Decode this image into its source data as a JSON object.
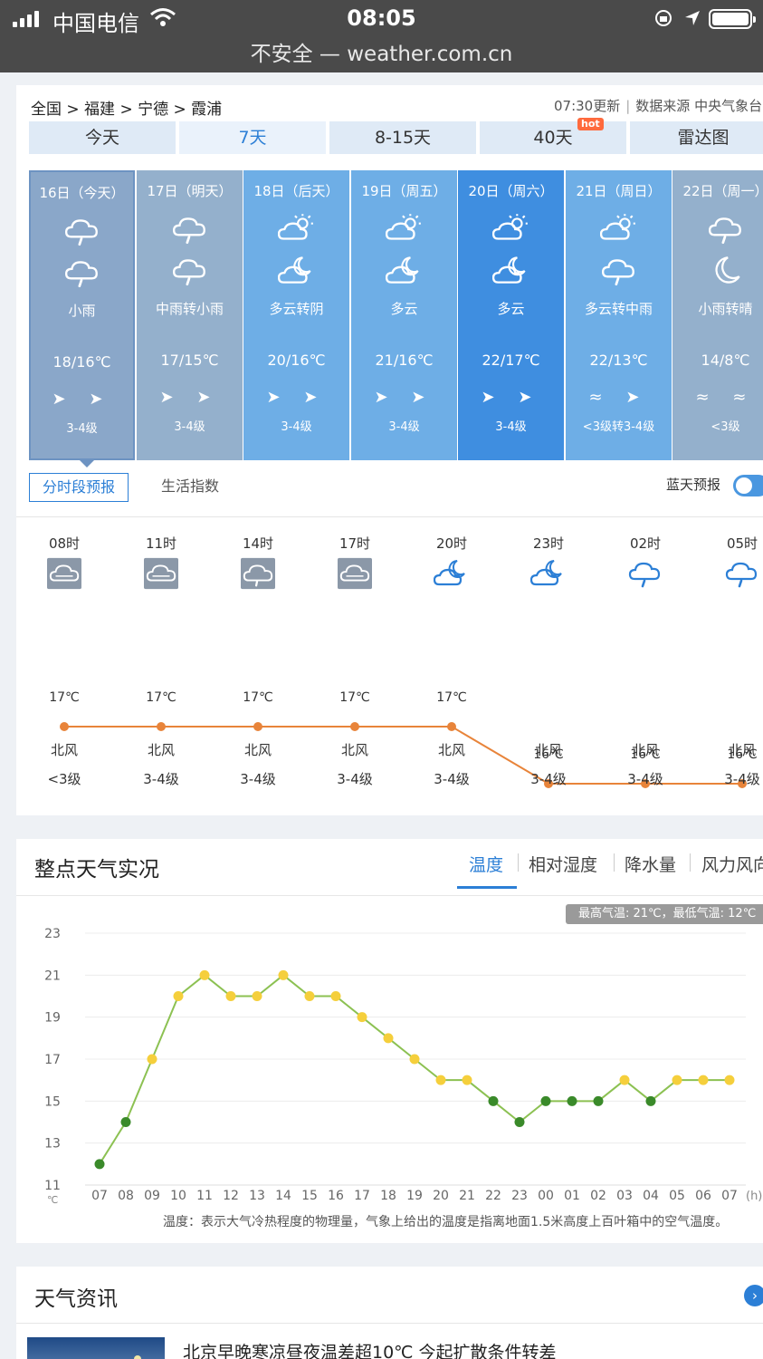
{
  "status_bar": {
    "carrier": "中国电信",
    "time": "08:05",
    "url": "不安全 — weather.com.cn"
  },
  "header": {
    "breadcrumb": "全国 > 福建 > 宁德 > 霞浦",
    "update_time": "07:30更新",
    "source": "数据来源 中央气象台"
  },
  "tabs": [
    {
      "label": "今天",
      "active": false
    },
    {
      "label": "7天",
      "active": true
    },
    {
      "label": "8-15天",
      "active": false
    },
    {
      "label": "40天",
      "active": false,
      "badge": "hot"
    },
    {
      "label": "雷达图",
      "active": false
    }
  ],
  "days": [
    {
      "date": "16日（今天）",
      "icon_day": "rain-cloud-icon",
      "icon_night": "rain-cloud-icon",
      "desc": "小雨",
      "temp": "18/16℃",
      "wind": "➤ ➤",
      "level": "3-4级",
      "color": "#8aa7c9",
      "selected": true
    },
    {
      "date": "17日（明天）",
      "icon_day": "rain-cloud-icon",
      "icon_night": "rain-cloud-icon",
      "desc": "中雨转小雨",
      "temp": "17/15℃",
      "wind": "➤ ➤",
      "level": "3-4级",
      "color": "#94b0cc",
      "selected": false
    },
    {
      "date": "18日（后天）",
      "icon_day": "partly-cloudy-icon",
      "icon_night": "cloudy-night-icon",
      "desc": "多云转阴",
      "temp": "20/16℃",
      "wind": "➤ ➤",
      "level": "3-4级",
      "color": "#6eaee6",
      "selected": false
    },
    {
      "date": "19日（周五）",
      "icon_day": "partly-cloudy-icon",
      "icon_night": "cloudy-night-icon",
      "desc": "多云",
      "temp": "21/16℃",
      "wind": "➤ ➤",
      "level": "3-4级",
      "color": "#6eaee6",
      "selected": false
    },
    {
      "date": "20日（周六）",
      "icon_day": "partly-cloudy-icon",
      "icon_night": "cloudy-night-icon",
      "desc": "多云",
      "temp": "22/17℃",
      "wind": "➤ ➤",
      "level": "3-4级",
      "color": "#3f8ee0",
      "selected": false
    },
    {
      "date": "21日（周日）",
      "icon_day": "partly-cloudy-icon",
      "icon_night": "rain-cloud-icon",
      "desc": "多云转中雨",
      "temp": "22/13℃",
      "wind": "≈ ➤",
      "level": "<3级转3-4级",
      "color": "#6eaee6",
      "selected": false
    },
    {
      "date": "22日（周一）",
      "icon_day": "rain-cloud-icon",
      "icon_night": "moon-icon",
      "desc": "小雨转晴",
      "temp": "14/8℃",
      "wind": "≈ ≈",
      "level": "<3级",
      "color": "#94b0cc",
      "selected": false
    }
  ],
  "sub_tabs": {
    "hourly": "分时段预报",
    "life": "生活指数",
    "blue_sky": "蓝天预报"
  },
  "hourly": [
    {
      "time": "08时",
      "icon": "overcast-icon",
      "temp": "17℃",
      "temp_value": 17,
      "wind": "北风",
      "level": "<3级"
    },
    {
      "time": "11时",
      "icon": "overcast-icon",
      "temp": "17℃",
      "temp_value": 17,
      "wind": "北风",
      "level": "3-4级"
    },
    {
      "time": "14时",
      "icon": "rain-box-icon",
      "temp": "17℃",
      "temp_value": 17,
      "wind": "北风",
      "level": "3-4级"
    },
    {
      "time": "17时",
      "icon": "overcast-icon",
      "temp": "17℃",
      "temp_value": 17,
      "wind": "北风",
      "level": "3-4级"
    },
    {
      "time": "20时",
      "icon": "cloudy-night-icon",
      "temp": "17℃",
      "temp_value": 17,
      "wind": "北风",
      "level": "3-4级"
    },
    {
      "time": "23时",
      "icon": "cloudy-night-icon",
      "temp": "16℃",
      "temp_value": 16,
      "wind": "北风",
      "level": "3-4级"
    },
    {
      "time": "02时",
      "icon": "rain-cloud-icon",
      "temp": "16℃",
      "temp_value": 16,
      "wind": "北风",
      "level": "3-4级"
    },
    {
      "time": "05时",
      "icon": "rain-cloud-icon",
      "temp": "16℃",
      "temp_value": 16,
      "wind": "北风",
      "level": "3-4级"
    }
  ],
  "observations": {
    "title": "整点天气实况",
    "tabs": [
      "温度",
      "相对湿度",
      "降水量",
      "风力风向"
    ],
    "max_min": "最高气温: 21℃，最低气温: 12℃",
    "note": "温度：表示大气冷热程度的物理量，气象上给出的温度是指离地面1.5米高度上百叶箱中的空气温度。",
    "unit": "℃",
    "x_unit": "(h)"
  },
  "chart_data": {
    "type": "line",
    "title": "",
    "xlabel": "(h)",
    "ylabel": "℃",
    "categories": [
      "07",
      "08",
      "09",
      "10",
      "11",
      "12",
      "13",
      "14",
      "15",
      "16",
      "17",
      "18",
      "19",
      "20",
      "21",
      "22",
      "23",
      "00",
      "01",
      "02",
      "03",
      "04",
      "05",
      "06",
      "07"
    ],
    "values": [
      12,
      14,
      17,
      20,
      21,
      20,
      20,
      21,
      20,
      20,
      19,
      18,
      17,
      16,
      16,
      15,
      14,
      15,
      15,
      15,
      16,
      15,
      16,
      16,
      16
    ],
    "point_colors": [
      "green",
      "green",
      "yellow",
      "yellow",
      "yellow",
      "yellow",
      "yellow",
      "yellow",
      "yellow",
      "yellow",
      "yellow",
      "yellow",
      "yellow",
      "yellow",
      "yellow",
      "green",
      "green",
      "green",
      "green",
      "green",
      "yellow",
      "green",
      "yellow",
      "yellow",
      "yellow"
    ],
    "yticks": [
      11,
      13,
      15,
      17,
      19,
      21,
      23
    ],
    "ylim": [
      11,
      23
    ],
    "grid": true,
    "colors": {
      "line": "#8cc152",
      "yellow": "#f5cf3c",
      "green": "#3a8a2a"
    }
  },
  "news": {
    "title": "天气资讯",
    "headline": "北京早晚寒凉昼夜温差超10℃ 今起扩散条件转差"
  },
  "colors": {
    "accent": "#2c7fd6",
    "hourly_line": "#e8843a"
  }
}
